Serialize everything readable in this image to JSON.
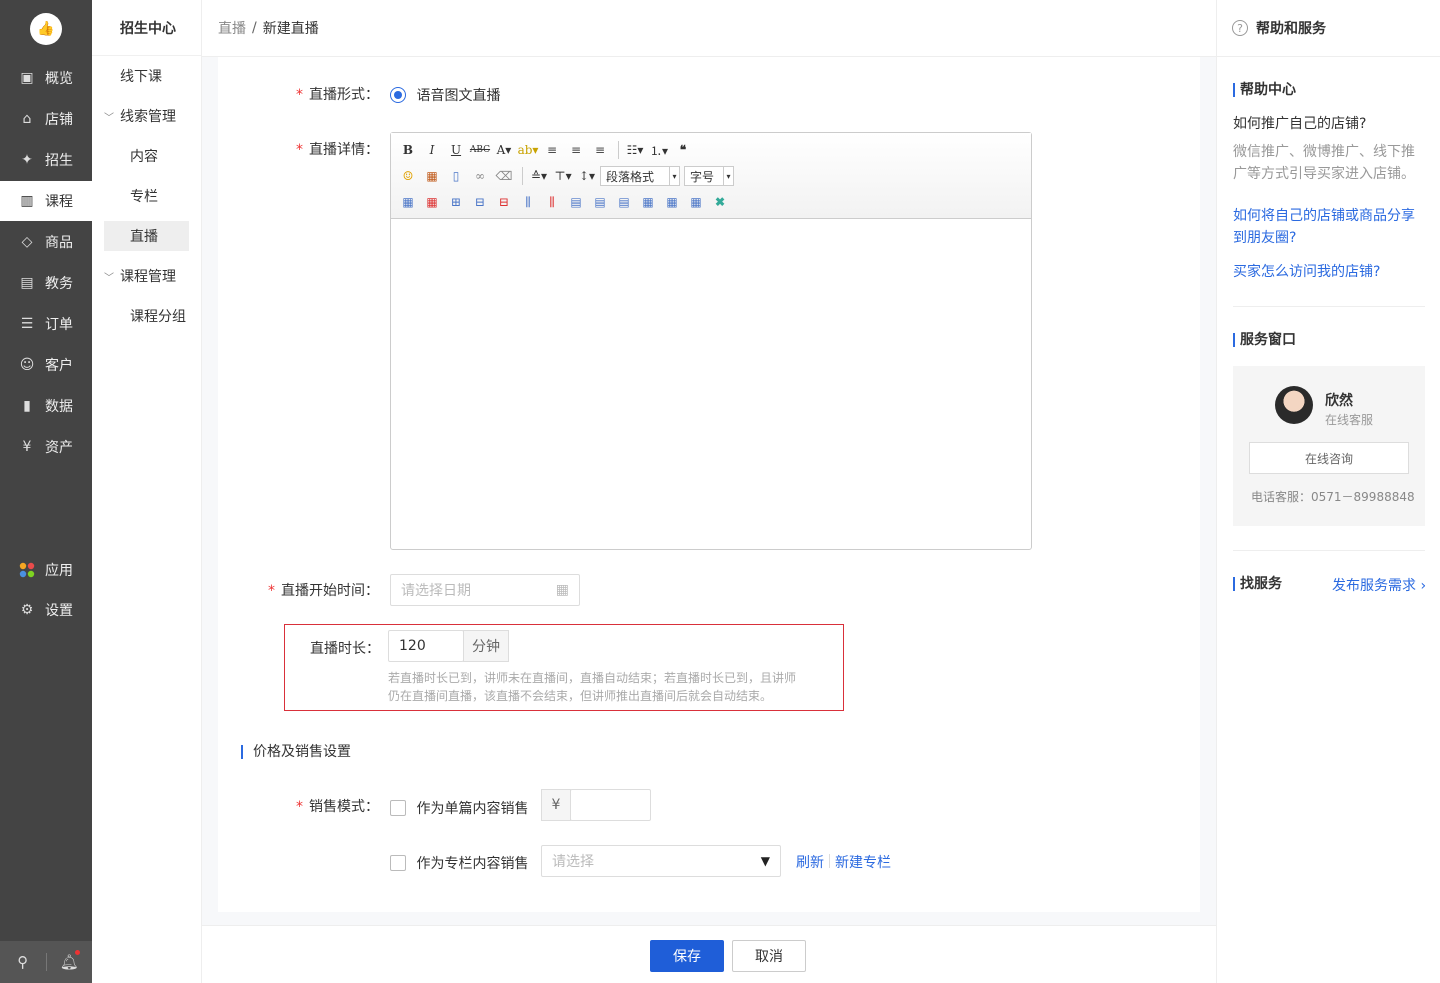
{
  "nav": {
    "items": [
      {
        "label": "概览",
        "icon": "overview-icon",
        "glyph": "▣"
      },
      {
        "label": "店铺",
        "icon": "store-icon",
        "glyph": "⌂"
      },
      {
        "label": "招生",
        "icon": "enroll-icon",
        "glyph": "✦"
      },
      {
        "label": "课程",
        "icon": "course-icon",
        "glyph": "▥"
      },
      {
        "label": "商品",
        "icon": "tag-icon",
        "glyph": "◇"
      },
      {
        "label": "教务",
        "icon": "academic-icon",
        "glyph": "▤"
      },
      {
        "label": "订单",
        "icon": "order-icon",
        "glyph": "☰"
      },
      {
        "label": "客户",
        "icon": "customer-icon",
        "glyph": "☺"
      },
      {
        "label": "数据",
        "icon": "data-icon",
        "glyph": "▮"
      },
      {
        "label": "资产",
        "icon": "asset-icon",
        "glyph": "¥"
      }
    ],
    "apps_label": "应用",
    "settings_label": "设置"
  },
  "subnav": {
    "title": "招生中心",
    "items": {
      "offline": "线下课",
      "leads": "线索管理",
      "content": "内容",
      "column": "专栏",
      "live": "直播",
      "course_mgmt": "课程管理",
      "course_group": "课程分组"
    }
  },
  "breadcrumb": {
    "parent": "直播",
    "separator": "/",
    "current": "新建直播"
  },
  "form": {
    "live_type_label": "直播形式：",
    "live_type_value": "语音图文直播",
    "detail_label": "直播详情：",
    "toolbar": {
      "paragraph_format": "段落格式",
      "font_size": "字号"
    },
    "start_time_label": "直播开始时间：",
    "start_time_placeholder": "请选择日期",
    "duration_label": "直播时长：",
    "duration_value": "120",
    "duration_unit": "分钟",
    "duration_hint": "若直播时长已到，讲师未在直播间，直播自动结束；若直播时长已到，且讲师仍在直播间直播，该直播不会结束，但讲师推出直播间后就会自动结束。",
    "section_price": "价格及销售设置",
    "sale_mode_label": "销售模式：",
    "single_sale": "作为单篇内容销售",
    "currency": "¥",
    "column_sale": "作为专栏内容销售",
    "column_placeholder": "请选择",
    "refresh": "刷新",
    "new_column": "新建专栏"
  },
  "footer": {
    "save": "保存",
    "cancel": "取消"
  },
  "help": {
    "title": "帮助和服务",
    "help_center": "帮助中心",
    "q1": "如何推广自己的店铺?",
    "a1": "微信推广、微博推广、线下推广等方式引导买家进入店铺。",
    "q2": "如何将自己的店铺或商品分享到朋友圈?",
    "q3": "买家怎么访问我的店铺?",
    "service_window": "服务窗口",
    "agent_name": "欣然",
    "agent_role": "在线客服",
    "consult": "在线咨询",
    "phone": "电话客服：0571－89988848",
    "find_service": "找服务",
    "publish_demand": "发布服务需求 ›"
  }
}
